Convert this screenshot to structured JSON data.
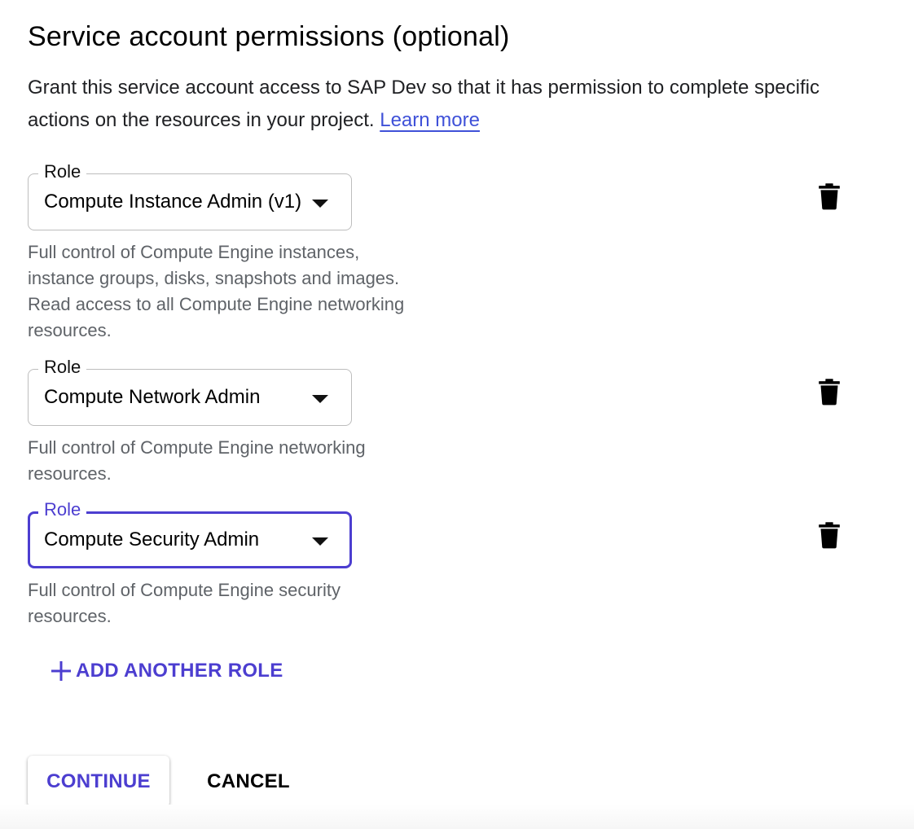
{
  "title": "Service account permissions (optional)",
  "intro": {
    "text": "Grant this service account access to SAP Dev so that it has permission to complete specific actions on the resources in your project. ",
    "link_label": "Learn more"
  },
  "roles": [
    {
      "label": "Role",
      "value": "Compute Instance Admin (v1)",
      "description": "Full control of Compute Engine instances, instance groups, disks, snapshots and images. Read access to all Compute Engine networking resources.",
      "focused": false
    },
    {
      "label": "Role",
      "value": "Compute Network Admin",
      "description": "Full control of Compute Engine networking resources.",
      "focused": false
    },
    {
      "label": "Role",
      "value": "Compute Security Admin",
      "description": "Full control of Compute Engine security resources.",
      "focused": true
    }
  ],
  "icons": {
    "delete": "trash-icon",
    "dropdown": "caret-down-icon",
    "add": "plus-icon"
  },
  "add_role_label": "ADD ANOTHER ROLE",
  "actions": {
    "continue_label": "CONTINUE",
    "cancel_label": "CANCEL"
  },
  "colors": {
    "accent": "#4c3ed0",
    "link": "#3f51d8",
    "description_text": "#5f6368",
    "field_border": "#bdbdbd"
  }
}
